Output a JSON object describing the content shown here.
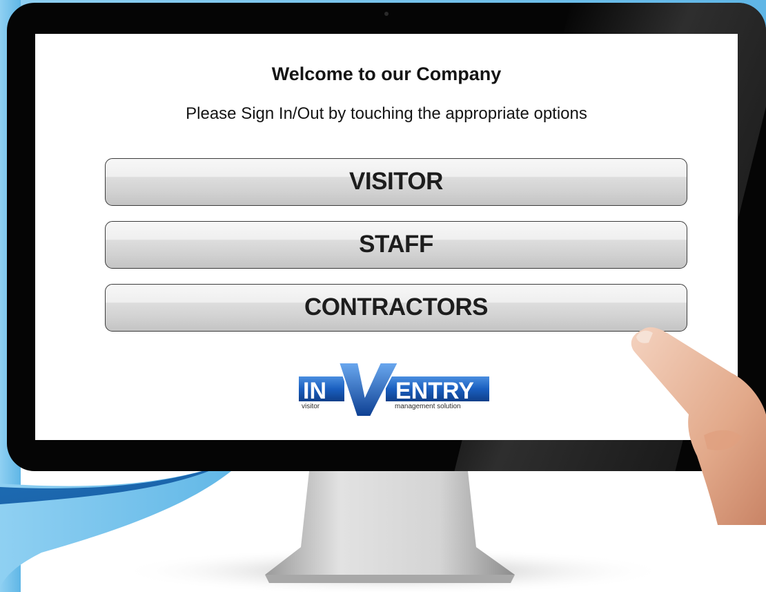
{
  "screen": {
    "welcome_title": "Welcome to our Company",
    "subtitle": "Please Sign In/Out by touching the appropriate options"
  },
  "options": [
    {
      "label": "VISITOR"
    },
    {
      "label": "STAFF"
    },
    {
      "label": "CONTRACTORS"
    }
  ],
  "logo": {
    "word_in": "IN",
    "word_v": "V",
    "word_entry": "ENTRY",
    "tagline_left": "visitor",
    "tagline_right": "management solution"
  },
  "colors": {
    "bezel": "#050505",
    "brand_blue": "#1a5fbf",
    "swoosh_blue": "#7ec8ef",
    "button_text": "#1d1d1d"
  },
  "icons": {
    "hand": "pointing-hand-icon",
    "camera": "webcam-dot-icon"
  }
}
